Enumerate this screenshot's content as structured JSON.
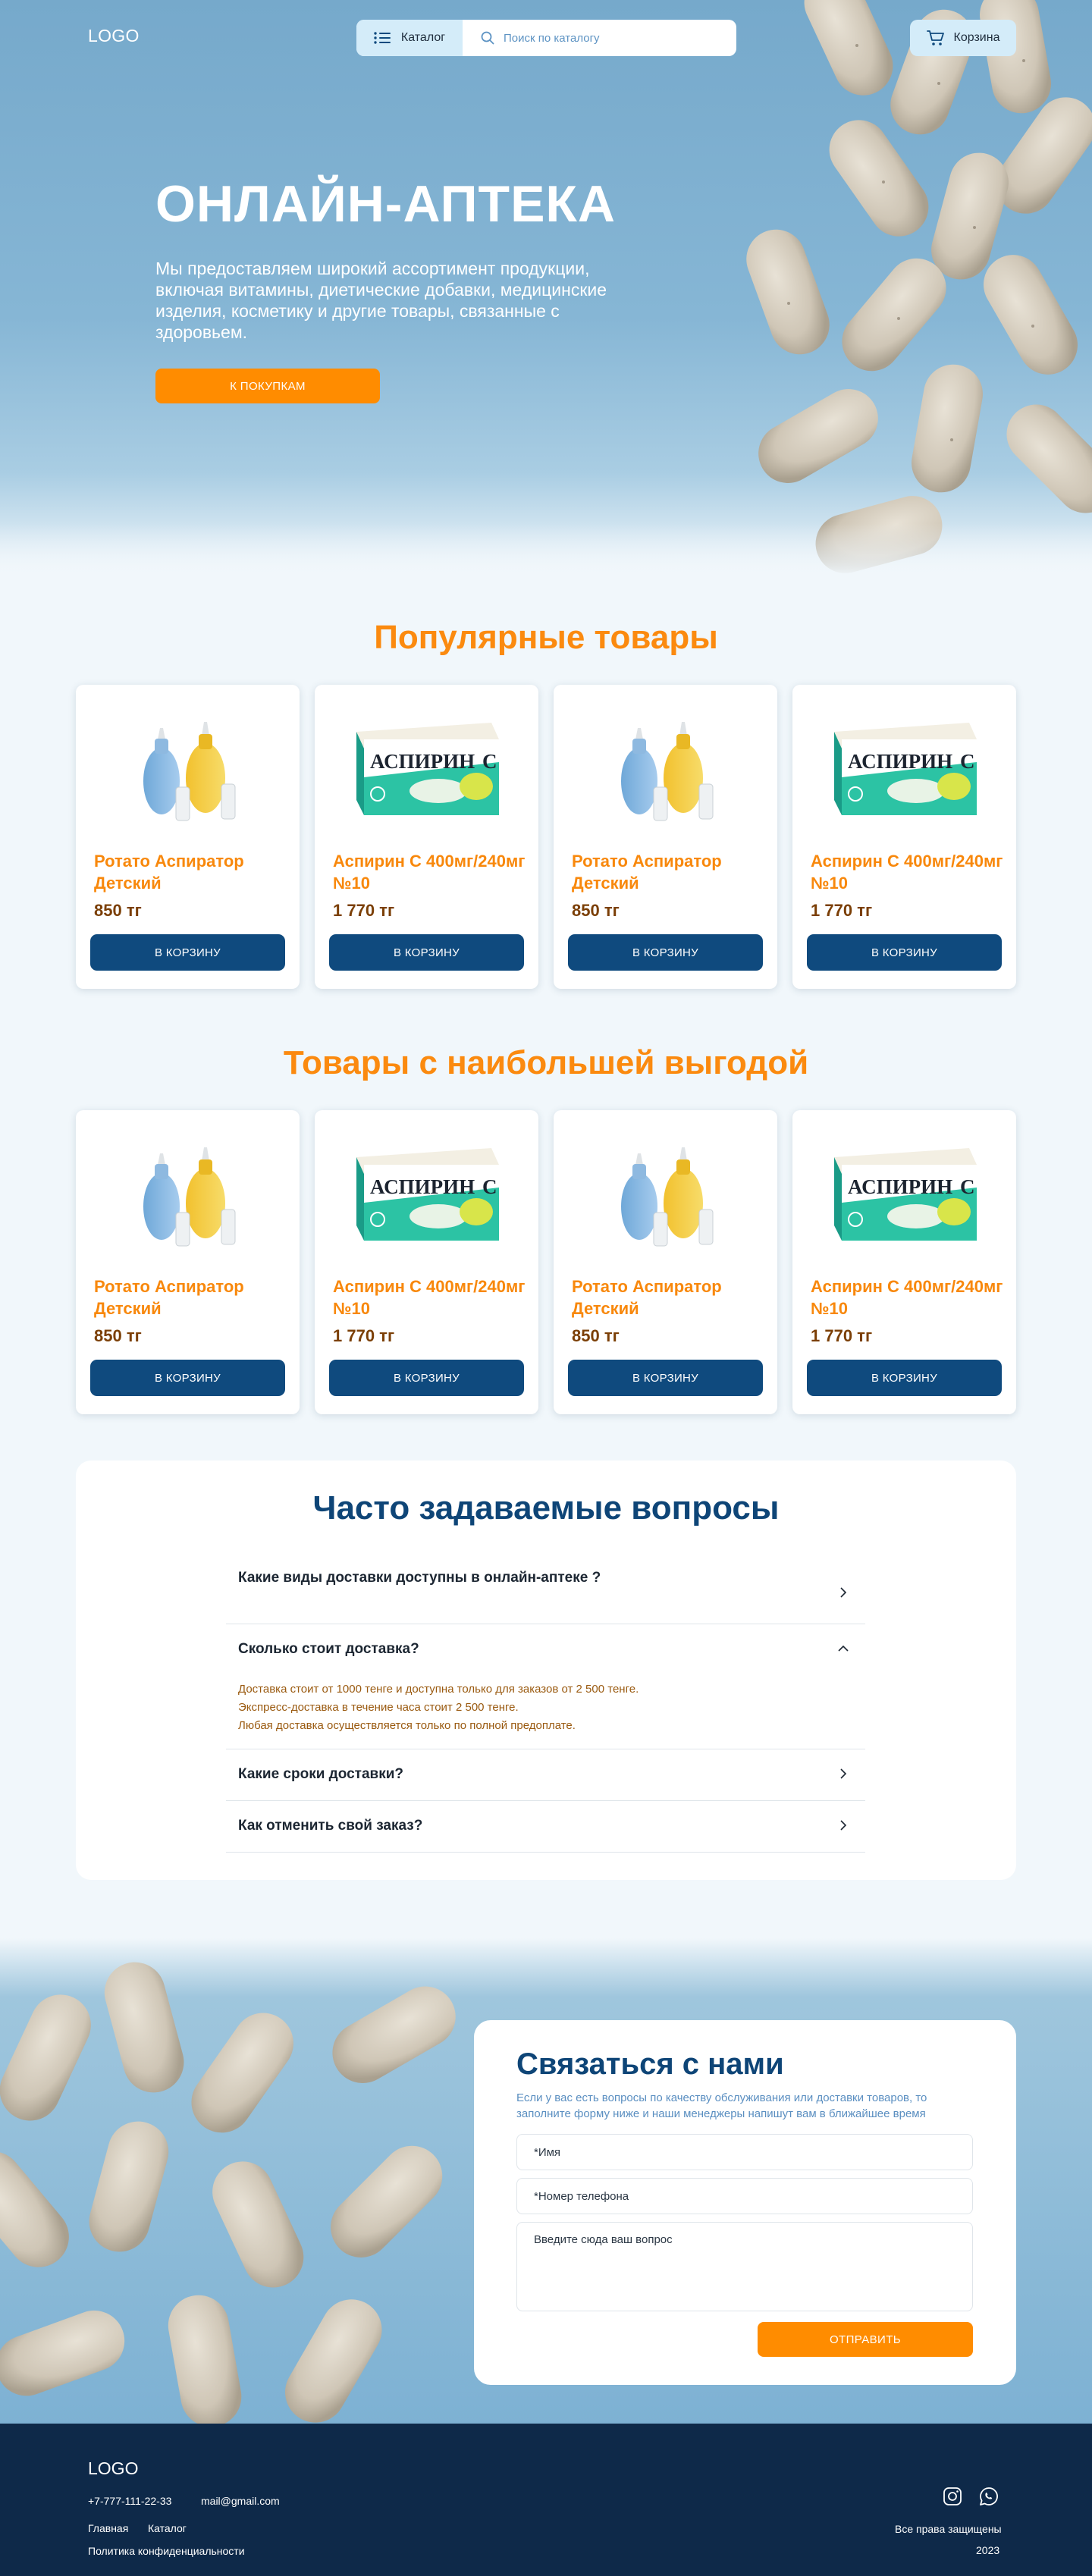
{
  "header": {
    "logo": "LOGO",
    "catalog_label": "Каталог",
    "search_placeholder": "Поиск по каталогу",
    "cart_label": "Корзина"
  },
  "hero": {
    "title": "ОНЛАЙН-АПТЕКА",
    "text": "Мы предоставляем широкий ассортимент продукции, включая  витамины, диетические добавки, медицинские изделия, косметику и другие товары, связанные с здоровьем.",
    "cta": "К ПОКУПКАМ"
  },
  "popular": {
    "title": "Популярные товары",
    "items": [
      {
        "name": "Ротато Аспиратор Детский",
        "price": "850 тг",
        "button": "В КОРЗИНУ",
        "image": "aspirator"
      },
      {
        "name": "Аспирин С 400мг/240мг №10",
        "price": "1 770 тг",
        "button": "В КОРЗИНУ",
        "image": "aspirin"
      },
      {
        "name": "Ротато Аспиратор Детский",
        "price": "850 тг",
        "button": "В КОРЗИНУ",
        "image": "aspirator"
      },
      {
        "name": "Аспирин С 400мг/240мг №10",
        "price": "1 770 тг",
        "button": "В КОРЗИНУ",
        "image": "aspirin"
      }
    ]
  },
  "best": {
    "title": "Товары с наибольшей выгодой",
    "items": [
      {
        "name": "Ротато Аспиратор Детский",
        "price": "850 тг",
        "button": "В КОРЗИНУ",
        "image": "aspirator"
      },
      {
        "name": "Аспирин С 400мг/240мг №10",
        "price": "1 770 тг",
        "button": "В КОРЗИНУ",
        "image": "aspirin"
      },
      {
        "name": "Ротато Аспиратор Детский",
        "price": "850 тг",
        "button": "В КОРЗИНУ",
        "image": "aspirator"
      },
      {
        "name": "Аспирин С 400мг/240мг №10",
        "price": "1 770 тг",
        "button": "В КОРЗИНУ",
        "image": "aspirin"
      }
    ]
  },
  "product_art": {
    "box_brand": "АСПИРИН",
    "box_suffix": "С"
  },
  "faq": {
    "title": "Часто задаваемые вопросы",
    "items": [
      {
        "q": "Какие виды доставки доступны в онлайн-аптеке ?",
        "open": false
      },
      {
        "q": "Сколько стоит доставка?",
        "open": true,
        "a": [
          "Доставка стоит от 1000 тенге и доступна только для заказов от 2 500 тенге.",
          "Экспресс-доставка в течение часа стоит 2 500 тенге.",
          "Любая доставка осуществляется только по полной предоплате."
        ]
      },
      {
        "q": "Какие сроки доставки?",
        "open": false
      },
      {
        "q": "Как отменить свой заказ?",
        "open": false
      }
    ]
  },
  "contact": {
    "title": "Связаться с нами",
    "subtitle": "Если у вас есть вопросы по качеству обслуживания или доставки товаров, то заполните форму ниже и наши менеджеры напишут вам в ближайшее время",
    "name_placeholder": "*Имя",
    "phone_placeholder": "*Номер телефона",
    "question_placeholder": "Введите сюда ваш вопрос",
    "submit": "ОТПРАВИТЬ"
  },
  "footer": {
    "logo": "LOGO",
    "phone": "+7-777-111-22-33",
    "email": "mail@gmail.com",
    "links": [
      "Главная",
      "Каталог"
    ],
    "privacy": "Политика конфиденциальности",
    "rights": "Все права защищены",
    "year": "2023",
    "social_icons": [
      "instagram-icon",
      "whatsapp-icon"
    ]
  },
  "colors": {
    "accent": "#ff8c00",
    "primary": "#0f4a7e",
    "footer": "#0e2949"
  }
}
